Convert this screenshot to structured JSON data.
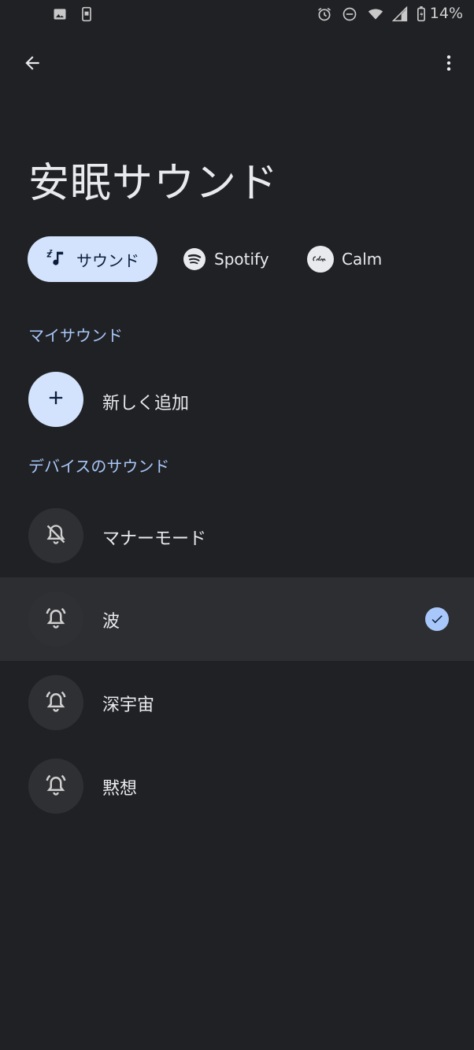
{
  "status_bar": {
    "battery_percent": "14%",
    "left_icons": [
      "image-icon",
      "screenshot-icon"
    ],
    "right_icons": [
      "alarm-icon",
      "dnd-icon",
      "wifi-icon",
      "signal-icon",
      "battery-icon"
    ]
  },
  "app_bar": {
    "back_icon": "arrow-back-icon",
    "menu_icon": "more-vert-icon"
  },
  "page_title": "安眠サウンド",
  "tabs": [
    {
      "label": "サウンド",
      "icon": "music-sleep-icon",
      "selected": true
    },
    {
      "label": "Spotify",
      "icon": "spotify-icon",
      "selected": false
    },
    {
      "label": "Calm",
      "icon": "calm-icon",
      "selected": false
    }
  ],
  "my_sounds": {
    "header": "マイサウンド",
    "add_label": "新しく追加"
  },
  "device_sounds": {
    "header": "デバイスのサウンド",
    "items": [
      {
        "label": "マナーモード",
        "icon": "bell-off-icon",
        "selected": false
      },
      {
        "label": "波",
        "icon": "alarm-bell-icon",
        "selected": true
      },
      {
        "label": "深宇宙",
        "icon": "alarm-bell-icon",
        "selected": false
      },
      {
        "label": "黙想",
        "icon": "alarm-bell-icon",
        "selected": false
      }
    ]
  },
  "colors": {
    "background": "#202124",
    "accent": "#a8c7fa",
    "chip_active": "#d3e3fd",
    "selected_row": "#2d2e31"
  }
}
